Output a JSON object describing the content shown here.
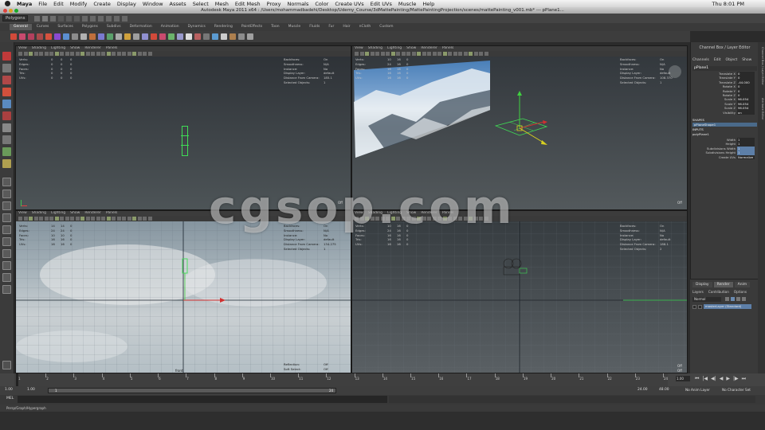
{
  "menubar": {
    "app": "Maya",
    "items": [
      "File",
      "Edit",
      "Modify",
      "Create",
      "Display",
      "Window",
      "Assets",
      "Select",
      "Mesh",
      "Edit Mesh",
      "Proxy",
      "Normals",
      "Color",
      "Create UVs",
      "Edit UVs",
      "Muscle",
      "Help"
    ],
    "clock": "Thu 8:01 PM"
  },
  "window": {
    "title": "Autodesk Maya 2011 x64 : /Users/mohammadbadehi/Desktop/Udemy_Course/3dMattePainting/MattePaintingProjection/scenes/mattePainting_v001.mb* --- pPlane1..."
  },
  "statusline": {
    "menuset": "Polygons"
  },
  "shelf": {
    "tabs": [
      "General",
      "Curves",
      "Surfaces",
      "Polygons",
      "Subdivs",
      "Deformation",
      "Animation",
      "Dynamics",
      "Rendering",
      "PaintEffects",
      "Toon",
      "Muscle",
      "Fluids",
      "Fur",
      "Hair",
      "nCloth",
      "Custom"
    ],
    "active": "General",
    "icon_colors": [
      "#d24a3a",
      "#c94a6e",
      "#b3405d",
      "#a84a4a",
      "#d6523e",
      "#8a4ad0",
      "#5b8fd1",
      "#8c8c8c",
      "#b1b1b1",
      "#c06f3c",
      "#7a7ad0",
      "#5aa16b",
      "#aaaaaa",
      "#cfa13c",
      "#9f9f9f",
      "#9090d0",
      "#d24a3a",
      "#c94a6e",
      "#6bb36b",
      "#9999cc",
      "#dddddd",
      "#b86060",
      "#777777",
      "#5b9bd1",
      "#cccccc",
      "#ad7f4e",
      "#8c8c8c",
      "#a0a0a0"
    ]
  },
  "viewport_menu": [
    "View",
    "Shading",
    "Lighting",
    "Show",
    "Renderer",
    "Panels"
  ],
  "hud": {
    "left_labels": [
      "Verts:",
      "Edges:",
      "Faces:",
      "Tris:",
      "UVs:"
    ],
    "right_labels": [
      "Backfaces:",
      "Smoothness:",
      "Instance:",
      "Display Layer:",
      "Distance From Camera:",
      "Selected Objects:"
    ],
    "top_left": {
      "values": [
        [
          "0",
          "0",
          "0"
        ],
        [
          "0",
          "0",
          "0"
        ],
        [
          "0",
          "0",
          "0"
        ],
        [
          "0",
          "0",
          "0"
        ],
        [
          "0",
          "0",
          "0"
        ]
      ],
      "right_values": [
        "On",
        "N/A",
        "No",
        "default",
        "185.1",
        "1"
      ]
    },
    "top_right": {
      "values": [
        [
          "10",
          "16",
          "0"
        ],
        [
          "24",
          "16",
          "0"
        ],
        [
          "16",
          "16",
          "0"
        ],
        [
          "16",
          "16",
          "0"
        ],
        [
          "16",
          "16",
          "0"
        ]
      ],
      "right_values": [
        "On",
        "N/A",
        "No",
        "default",
        "108.370",
        "1"
      ]
    },
    "bottom_left": {
      "values": [
        [
          "14",
          "14",
          "0"
        ],
        [
          "24",
          "24",
          "0"
        ],
        [
          "10",
          "10",
          "0"
        ],
        [
          "16",
          "16",
          "0"
        ],
        [
          "16",
          "16",
          "0"
        ]
      ],
      "right_values": [
        "On",
        "N/A",
        "No",
        "default",
        "134.275",
        "1"
      ],
      "extra": [
        [
          "Reflection:",
          "Off"
        ],
        [
          "Soft Select:",
          "Off"
        ]
      ]
    },
    "bottom_right": {
      "values": [
        [
          "10",
          "16",
          "0"
        ],
        [
          "24",
          "16",
          "0"
        ],
        [
          "16",
          "16",
          "0"
        ],
        [
          "16",
          "16",
          "0"
        ],
        [
          "16",
          "16",
          "0"
        ]
      ],
      "right_values": [
        "On",
        "N/A",
        "No",
        "default",
        "188.1",
        "2"
      ]
    }
  },
  "cameras": {
    "top_left": "front",
    "bottom_left": "front",
    "top_right": "persp",
    "bottom_right": "persp",
    "corner": "Off"
  },
  "channelbox": {
    "title": "Channel Box / Layer Editor",
    "tabs": [
      "Channels",
      "Edit",
      "Object",
      "Show"
    ],
    "object": "pPlane1",
    "attrs": [
      [
        "Translate X",
        "0"
      ],
      [
        "Translate Y",
        "0"
      ],
      [
        "Translate Z",
        "-44.000"
      ],
      [
        "Rotate X",
        "0"
      ],
      [
        "Rotate Y",
        "0"
      ],
      [
        "Rotate Z",
        "0"
      ],
      [
        "Scale X",
        "96.054"
      ],
      [
        "Scale Y",
        "96.054"
      ],
      [
        "Scale Z",
        "96.054"
      ],
      [
        "Visibility",
        "on"
      ]
    ],
    "shapes_header": "SHAPES",
    "shape_name": "pPlaneShape1",
    "inputs_header": "INPUTS",
    "input_name": "polyPlane1",
    "inputs": [
      [
        "Width",
        "1"
      ],
      [
        "Height",
        "1"
      ],
      [
        "Subdivisions Width",
        "1"
      ],
      [
        "Subdivisions Height",
        "1"
      ],
      [
        "Create UVs",
        "Normalize"
      ]
    ],
    "side_tabs": [
      "Channel Box / Layer Editor",
      "Attribute Editor"
    ]
  },
  "layers": {
    "tabs": [
      "Display",
      "Render",
      "Anim"
    ],
    "active_tab": "Render",
    "menu": [
      "Layers",
      "Contribution",
      "Options"
    ],
    "blend": "Normal",
    "layer_name": "masterLayer (Standard)"
  },
  "timeline": {
    "ticks": [
      "1",
      "2",
      "3",
      "4",
      "5",
      "6",
      "7",
      "8",
      "9",
      "10",
      "11",
      "12",
      "13",
      "14",
      "15",
      "16",
      "17",
      "18",
      "19",
      "20",
      "21",
      "22",
      "23",
      "24"
    ],
    "current": "1.00"
  },
  "range": {
    "start": "1.00",
    "start2": "1.00",
    "slider_start": "1",
    "slider_end": "24",
    "end": "24.00",
    "end2": "48.00",
    "anim_layer": "No Anim Layer",
    "char_set": "No Character Set"
  },
  "cmdline": {
    "label": "MEL"
  },
  "helpline": {
    "text": "Persp/Graph/Hypergraph"
  },
  "watermark": "cgsop.com"
}
